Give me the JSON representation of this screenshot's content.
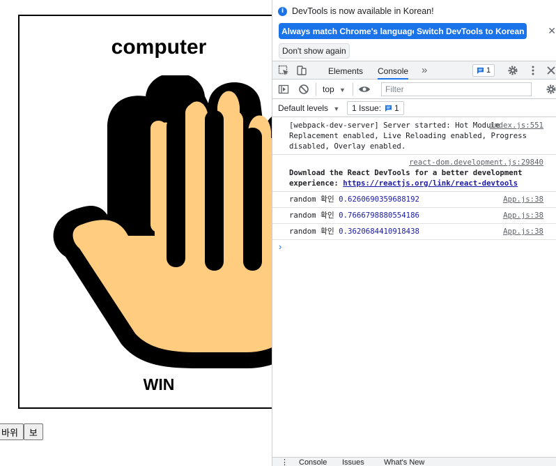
{
  "page": {
    "title": "computer",
    "result": "WIN",
    "buttons": [
      "바위",
      "보"
    ]
  },
  "devtools": {
    "notice": "DevTools is now available in Korean!",
    "btn_match": "Always match Chrome's language",
    "btn_switch": "Switch DevTools to Korean",
    "btn_dont_show": "Don't show again",
    "tabs": [
      "Elements",
      "Console"
    ],
    "more_tabs": "»",
    "messages_count": "1",
    "context": "top",
    "filter_placeholder": "Filter",
    "levels": "Default levels",
    "issues": "1 Issue:",
    "issues_count": "1",
    "logs": [
      {
        "text": "[webpack-dev-server] Server started: Hot Module Replacement enabled, Live Reloading enabled, Progress disabled, Overlay enabled.",
        "src": "index.js:551"
      },
      {
        "text": "Download the React DevTools for a better development experience: ",
        "link": "https://reactjs.org/link/react-devtools",
        "src": "react-dom.development.js:29840"
      },
      {
        "label": "random 확인",
        "value": "0.6260690359688192",
        "src": "App.js:38"
      },
      {
        "label": "random 확인",
        "value": "0.7666798880554186",
        "src": "App.js:38"
      },
      {
        "label": "random 확인",
        "value": "0.3620684410918438",
        "src": "App.js:38"
      }
    ],
    "prompt": "›",
    "drawer_tabs": [
      "Console",
      "Issues",
      "What's New"
    ],
    "colors": {
      "accent": "#1a73e8",
      "value_blue": "#1a1aa6",
      "hand_fill": "#ffcc80"
    }
  }
}
